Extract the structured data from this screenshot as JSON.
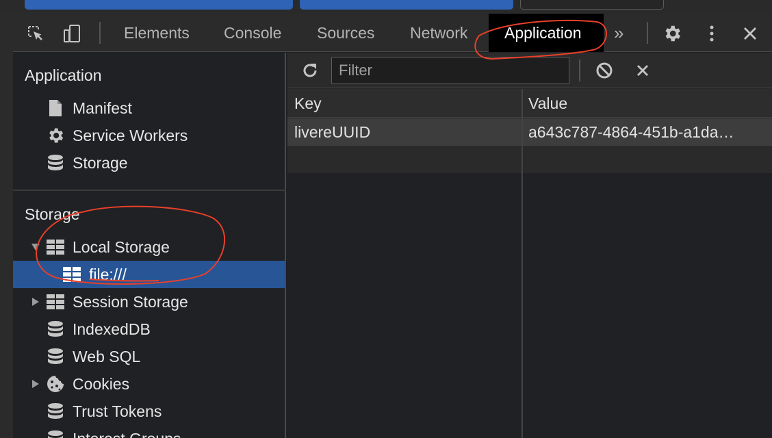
{
  "toolbar": {
    "tabs": [
      {
        "label": "Elements"
      },
      {
        "label": "Console"
      },
      {
        "label": "Sources"
      },
      {
        "label": "Network"
      },
      {
        "label": "Application"
      }
    ],
    "more": "»"
  },
  "sidebar": {
    "application_title": "Application",
    "application_items": [
      {
        "label": "Manifest",
        "icon": "document-icon"
      },
      {
        "label": "Service Workers",
        "icon": "gear-icon"
      },
      {
        "label": "Storage",
        "icon": "database-icon"
      }
    ],
    "storage_title": "Storage",
    "storage_items": [
      {
        "label": "Local Storage",
        "icon": "grid-icon",
        "expanded": true
      },
      {
        "label": "file:///",
        "icon": "grid-icon",
        "selected": true
      },
      {
        "label": "Session Storage",
        "icon": "grid-icon"
      },
      {
        "label": "IndexedDB",
        "icon": "database-icon"
      },
      {
        "label": "Web SQL",
        "icon": "database-icon"
      },
      {
        "label": "Cookies",
        "icon": "cookie-icon"
      },
      {
        "label": "Trust Tokens",
        "icon": "database-icon"
      },
      {
        "label": "Interest Groups",
        "icon": "database-icon"
      }
    ]
  },
  "filter": {
    "placeholder": "Filter",
    "value": ""
  },
  "table": {
    "columns": [
      "Key",
      "Value"
    ],
    "rows": [
      {
        "key": "livereUUID",
        "value": "a643c787-4864-451b-a1da…"
      }
    ]
  },
  "colors": {
    "accent": "#275596",
    "annotation": "#e8402a"
  }
}
